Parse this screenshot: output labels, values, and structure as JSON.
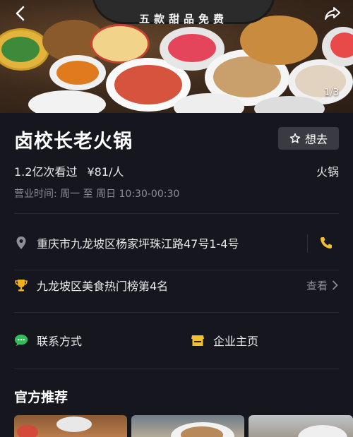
{
  "hero": {
    "banner_text": "五款甜品免费",
    "page_indicator": "1/3"
  },
  "shop": {
    "name": "卤校长老火锅",
    "want_label": "想去",
    "views": "1.2亿次看过",
    "price": "¥81/人",
    "category": "火锅",
    "hours": "营业时间: 周一 至 周日  10:30-00:30"
  },
  "address": {
    "text": "重庆市九龙坡区杨家坪珠江路47号1-4号"
  },
  "ranking": {
    "text": "九龙坡区美食热门榜第4名",
    "link_label": "查看"
  },
  "contact": {
    "contact_label": "联系方式",
    "homepage_label": "企业主页"
  },
  "recommend": {
    "title": "官方推荐"
  },
  "colors": {
    "background": "#16161e",
    "phone_accent": "#f5c02c",
    "chat_green": "#2fbf5a",
    "store_yellow": "#f5c02c",
    "trophy_gold": "#f2b01e"
  }
}
